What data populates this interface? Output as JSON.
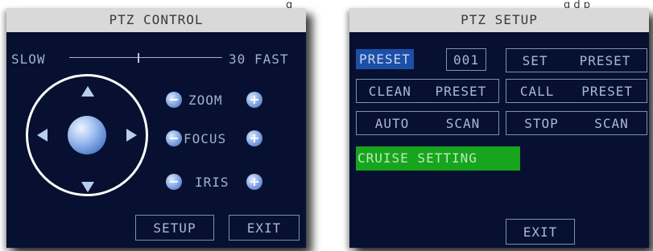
{
  "top_fragments": {
    "left": "g",
    "right": "g    d      p"
  },
  "ptz_control": {
    "title": "PTZ CONTROL",
    "speed": {
      "slow_label": "SLOW",
      "value": "30",
      "fast_label": "FAST",
      "level_fraction": 0.45
    },
    "zoom_label": "ZOOM",
    "focus_label": "FOCUS",
    "iris_label": "IRIS",
    "minus_symbol": "−",
    "plus_symbol": "+",
    "setup_label": "SETUP",
    "exit_label": "EXIT"
  },
  "ptz_setup": {
    "title": "PTZ SETUP",
    "preset_label": "PRESET",
    "preset_number": "001",
    "set_preset": [
      "SET",
      "PRESET"
    ],
    "clean_preset": [
      "CLEAN",
      "PRESET"
    ],
    "call_preset": [
      "CALL",
      "PRESET"
    ],
    "auto_scan": [
      "AUTO",
      "SCAN"
    ],
    "stop_scan": [
      "STOP",
      "SCAN"
    ],
    "cruise_setting": "CRUISE SETTING",
    "exit_label": "EXIT"
  },
  "colors": {
    "panel_bg": "#071030",
    "title_bar": "#d9d9d9",
    "highlight_blue": "#1b4fa8",
    "highlight_green": "#16a51c",
    "text": "#9fb0cc"
  }
}
